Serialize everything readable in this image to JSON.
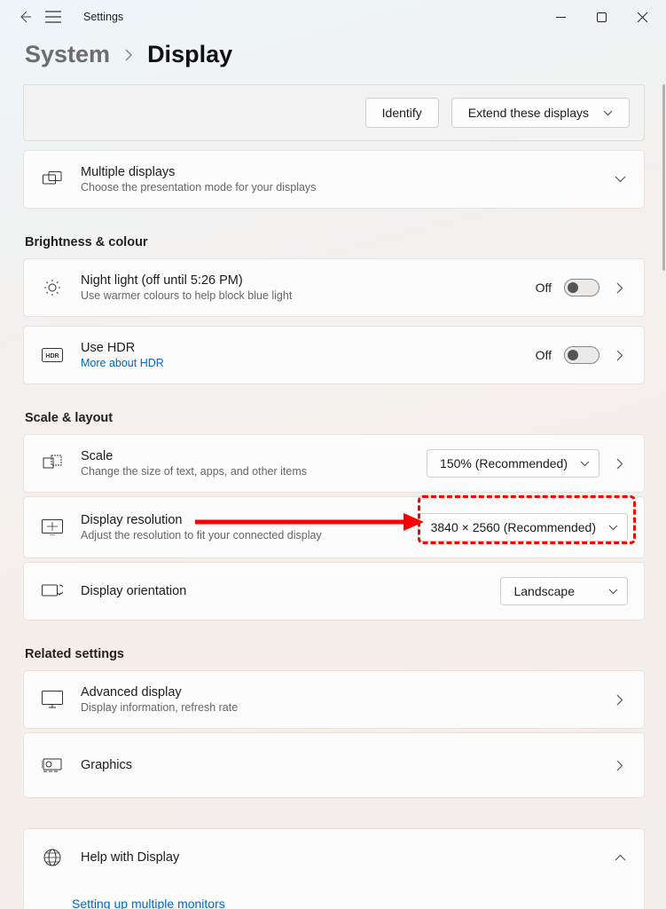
{
  "titlebar": {
    "title": "Settings"
  },
  "breadcrumb": {
    "parent": "System",
    "current": "Display"
  },
  "top_buttons": {
    "identify": "Identify",
    "extend": "Extend these displays"
  },
  "cards": {
    "multiple_displays": {
      "title": "Multiple displays",
      "sub": "Choose the presentation mode for your displays"
    }
  },
  "sections": {
    "brightness": {
      "header": "Brightness & colour",
      "night_light": {
        "title": "Night light (off until 5:26 PM)",
        "sub": "Use warmer colours to help block blue light",
        "status": "Off"
      },
      "hdr": {
        "title": "Use HDR",
        "link": "More about HDR",
        "status": "Off"
      }
    },
    "scale": {
      "header": "Scale & layout",
      "scale": {
        "title": "Scale",
        "sub": "Change the size of text, apps, and other items",
        "value": "150% (Recommended)"
      },
      "resolution": {
        "title": "Display resolution",
        "sub": "Adjust the resolution to fit your connected display",
        "value": "3840 × 2560 (Recommended)"
      },
      "orientation": {
        "title": "Display orientation",
        "value": "Landscape"
      }
    },
    "related": {
      "header": "Related settings",
      "advanced": {
        "title": "Advanced display",
        "sub": "Display information, refresh rate"
      },
      "graphics": {
        "title": "Graphics"
      }
    },
    "help": {
      "title": "Help with Display",
      "link": "Setting up multiple monitors"
    }
  }
}
